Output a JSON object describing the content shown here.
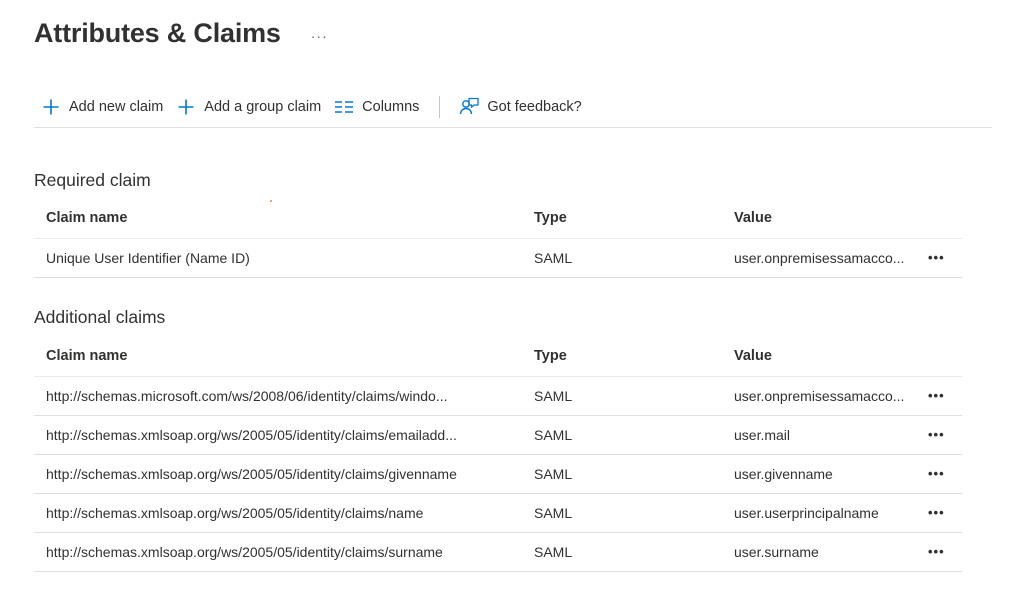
{
  "page": {
    "title": "Attributes & Claims",
    "more_label": "···"
  },
  "toolbar": {
    "add_new_claim": "Add new claim",
    "add_group_claim": "Add a group claim",
    "columns": "Columns",
    "feedback": "Got feedback?"
  },
  "icons": {
    "add": "plus-icon",
    "columns": "columns-icon",
    "feedback": "feedback-icon",
    "accent_color": "#0078d4"
  },
  "required": {
    "title": "Required claim",
    "headers": {
      "name": "Claim name",
      "type": "Type",
      "value": "Value"
    },
    "rows": [
      {
        "name": "Unique User Identifier (Name ID)",
        "type": "SAML",
        "value": "user.onpremisessamacco...",
        "more": "•••"
      }
    ]
  },
  "additional": {
    "title": "Additional claims",
    "headers": {
      "name": "Claim name",
      "type": "Type",
      "value": "Value"
    },
    "rows": [
      {
        "name": "http://schemas.microsoft.com/ws/2008/06/identity/claims/windo...",
        "type": "SAML",
        "value": "user.onpremisessamacco...",
        "more": "•••"
      },
      {
        "name": "http://schemas.xmlsoap.org/ws/2005/05/identity/claims/emailadd...",
        "type": "SAML",
        "value": "user.mail",
        "more": "•••"
      },
      {
        "name": "http://schemas.xmlsoap.org/ws/2005/05/identity/claims/givenname",
        "type": "SAML",
        "value": "user.givenname",
        "more": "•••"
      },
      {
        "name": "http://schemas.xmlsoap.org/ws/2005/05/identity/claims/name",
        "type": "SAML",
        "value": "user.userprincipalname",
        "more": "•••"
      },
      {
        "name": "http://schemas.xmlsoap.org/ws/2005/05/identity/claims/surname",
        "type": "SAML",
        "value": "user.surname",
        "more": "•••"
      }
    ]
  }
}
